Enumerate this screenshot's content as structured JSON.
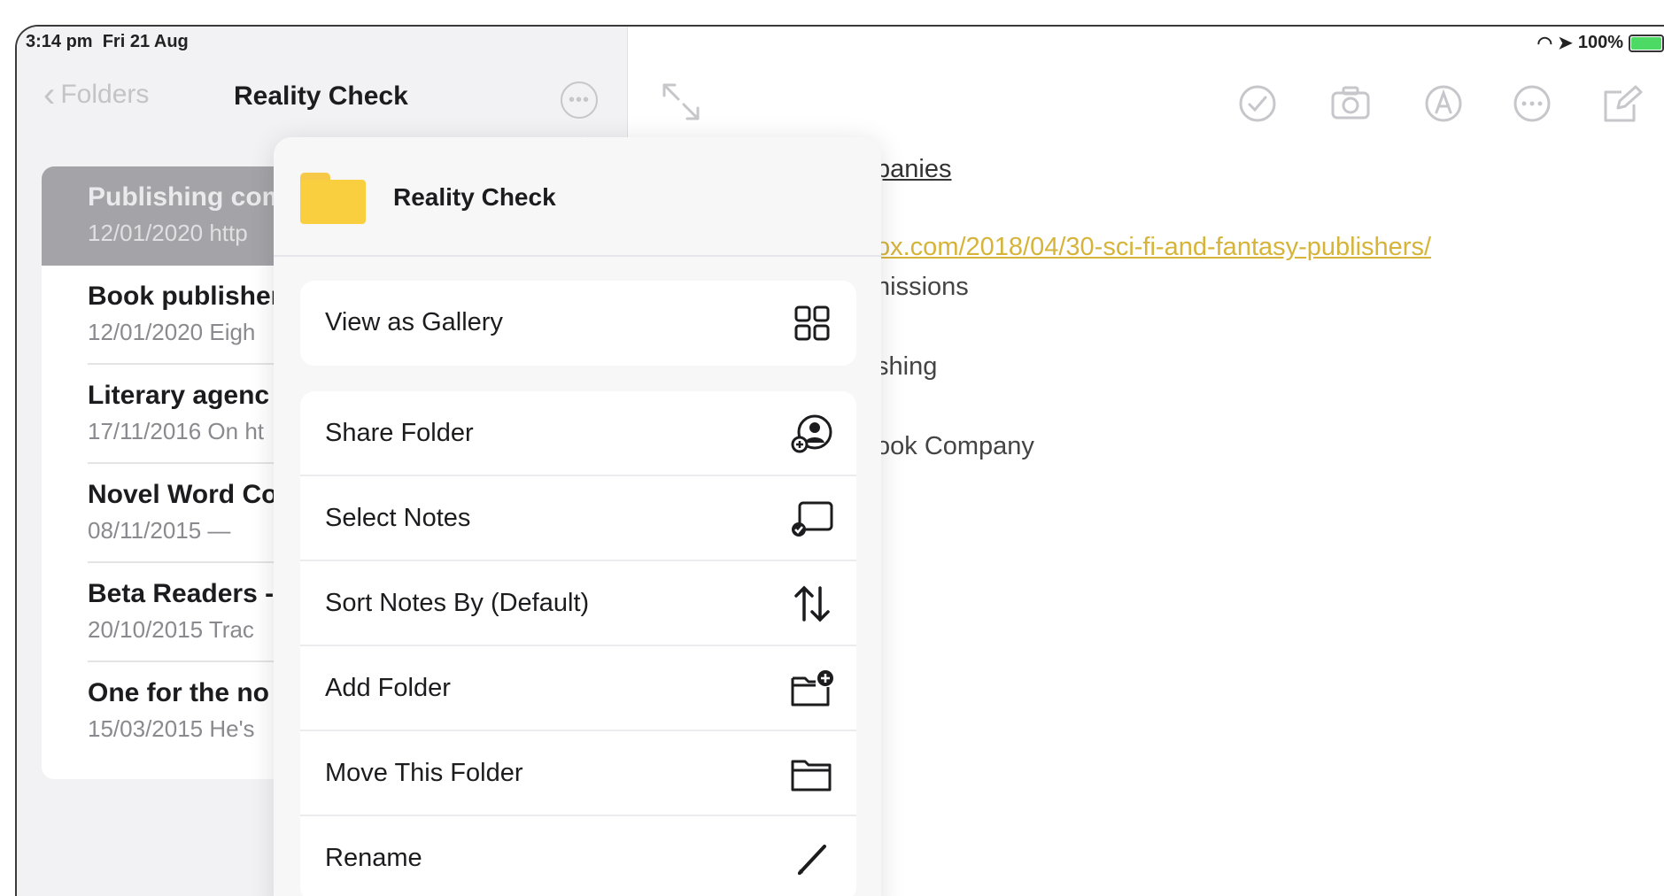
{
  "status_bar": {
    "time": "3:14 pm",
    "date": "Fri 21 Aug",
    "battery": "100%"
  },
  "nav": {
    "back_label": "Folders",
    "title": "Reality Check"
  },
  "notes": [
    {
      "title": "Publishing com",
      "meta": "12/01/2020  http",
      "selected": true
    },
    {
      "title": "Book publisher",
      "meta": "12/01/2020  Eigh",
      "selected": false
    },
    {
      "title": "Literary agenc",
      "meta": "17/11/2016  On ht",
      "selected": false
    },
    {
      "title": "Novel Word Co",
      "meta": "08/11/2015  —",
      "selected": false
    },
    {
      "title": "Beta Readers -",
      "meta": "20/10/2015  Trac",
      "selected": false
    },
    {
      "title": "One for the no",
      "meta": "15/03/2015  He's",
      "selected": false
    }
  ],
  "editor": {
    "lines": [
      {
        "text": "panies",
        "style": "underlined"
      },
      {
        "text": "ox.com/2018/04/30-sci-fi-and-fantasy-publishers/",
        "style": "link"
      },
      {
        "text": "nissions",
        "style": "plain"
      },
      {
        "text": "shing",
        "style": "plain"
      },
      {
        "text": "ook Company",
        "style": "plain"
      }
    ],
    "toolbar_icons": [
      "checklist-icon",
      "camera-icon",
      "markup-icon",
      "more-icon",
      "compose-icon"
    ]
  },
  "popover": {
    "folder_name": "Reality Check",
    "groups": [
      [
        {
          "label": "View as Gallery",
          "icon": "gallery-grid-icon"
        }
      ],
      [
        {
          "label": "Share Folder",
          "icon": "share-folder-icon"
        },
        {
          "label": "Select Notes",
          "icon": "select-notes-icon"
        },
        {
          "label": "Sort Notes By (Default)",
          "icon": "sort-arrows-icon"
        },
        {
          "label": "Add Folder",
          "icon": "add-folder-icon"
        },
        {
          "label": "Move This Folder",
          "icon": "move-folder-icon"
        },
        {
          "label": "Rename",
          "icon": "rename-pencil-icon"
        }
      ]
    ]
  },
  "colors": {
    "accent_yellow": "#f9cf3f",
    "link": "#d6b43a",
    "selected_row": "#a4a4a8",
    "battery_green": "#4cd964"
  }
}
